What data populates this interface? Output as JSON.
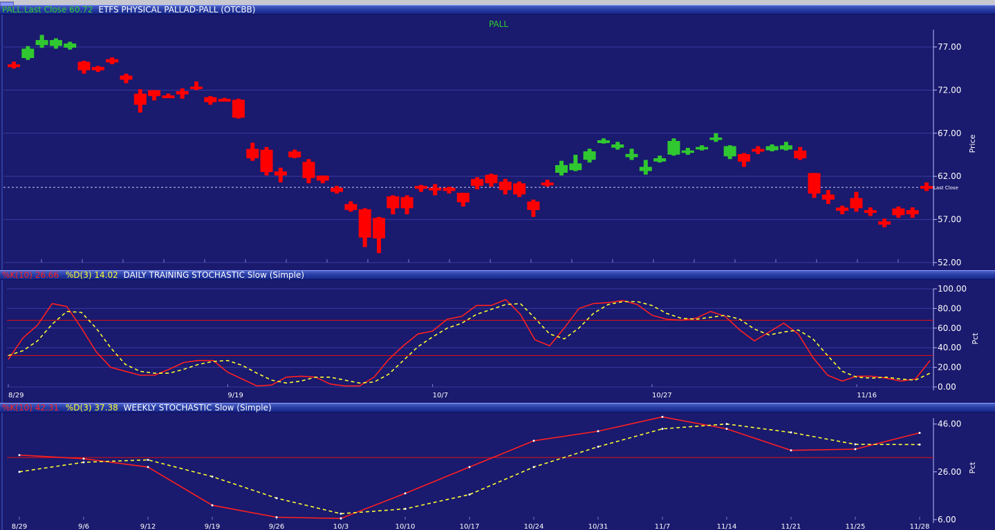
{
  "panels": {
    "price": {
      "header": {
        "symbol_close": "PALL.Last Close 60.72",
        "name": "ETFS PHYSICAL PALLAD-PALL (OTCBB)"
      },
      "title": "PALL",
      "ylabel": "Price",
      "last_close_label": "Last Close",
      "colors": {
        "up": "#30c830",
        "down": "#ff0000",
        "title": "#30d030"
      }
    },
    "daily": {
      "header": {
        "k": "%K(10) 26.66",
        "d": "%D(3) 14.02",
        "name": "DAILY TRAINING STOCHASTIC Slow (Simple)"
      },
      "ylabel": "Pct",
      "colors": {
        "k": "#ff2020",
        "d": "#ffff30"
      }
    },
    "weekly": {
      "header": {
        "k": "%K(10) 42.31",
        "d": "%D(3) 37.38",
        "name": "WEEKLY STOCHASTIC Slow (Simple)"
      },
      "ylabel": "Pct",
      "colors": {
        "k": "#ff2020",
        "d": "#ffff30"
      }
    }
  },
  "chart_data": [
    {
      "type": "candlestick",
      "title": "PALL",
      "ylabel": "Price",
      "ylim": [
        52,
        79
      ],
      "yticks": [
        "77.00",
        "72.00",
        "67.00",
        "62.00",
        "57.00",
        "52.00"
      ],
      "ytick_values": [
        77,
        72,
        67,
        62,
        57,
        52
      ],
      "last_close": 60.72,
      "grid": true,
      "candles": [
        [
          74.9,
          75.3,
          74.5,
          74.9,
          "down"
        ],
        [
          75.8,
          77.1,
          75.5,
          76.8,
          "up"
        ],
        [
          77.3,
          78.4,
          76.9,
          77.8,
          "up"
        ],
        [
          77.2,
          78.0,
          76.8,
          77.8,
          "up"
        ],
        [
          77.0,
          77.6,
          76.7,
          77.4,
          "up"
        ],
        [
          75.2,
          75.4,
          73.9,
          74.3,
          "down"
        ],
        [
          74.6,
          74.8,
          74.1,
          74.3,
          "down"
        ],
        [
          75.5,
          75.8,
          75.0,
          75.2,
          "down"
        ],
        [
          73.6,
          73.9,
          72.8,
          73.2,
          "down"
        ],
        [
          71.5,
          72.1,
          69.4,
          70.3,
          "down"
        ],
        [
          71.9,
          72.0,
          70.8,
          71.3,
          "down"
        ],
        [
          71.3,
          71.6,
          71.1,
          71.3,
          "down"
        ],
        [
          71.8,
          72.2,
          71.0,
          71.5,
          "down"
        ],
        [
          72.2,
          73.0,
          72.0,
          72.4,
          "down"
        ],
        [
          71.1,
          71.3,
          70.3,
          70.6,
          "down"
        ],
        [
          70.9,
          71.1,
          70.7,
          70.9,
          "down"
        ],
        [
          70.8,
          71.0,
          68.7,
          68.8,
          "down"
        ],
        [
          65.1,
          65.9,
          63.8,
          64.1,
          "down"
        ],
        [
          65.0,
          65.4,
          62.1,
          62.5,
          "down"
        ],
        [
          62.5,
          63.0,
          61.3,
          62.1,
          "down"
        ],
        [
          64.8,
          65.1,
          64.1,
          64.2,
          "down"
        ],
        [
          63.6,
          64.0,
          61.2,
          61.8,
          "down"
        ],
        [
          62.0,
          62.1,
          61.2,
          61.5,
          "down"
        ],
        [
          60.6,
          60.9,
          60.0,
          60.2,
          "down"
        ],
        [
          58.7,
          59.1,
          57.9,
          58.1,
          "down"
        ],
        [
          58.1,
          58.3,
          53.8,
          54.9,
          "down"
        ],
        [
          57.1,
          57.3,
          53.1,
          54.8,
          "down"
        ],
        [
          59.6,
          59.8,
          57.6,
          58.3,
          "down"
        ],
        [
          59.5,
          59.8,
          57.6,
          58.3,
          "down"
        ],
        [
          60.8,
          61.0,
          60.2,
          60.6,
          "down"
        ],
        [
          60.6,
          61.1,
          59.8,
          60.4,
          "down"
        ],
        [
          60.6,
          60.8,
          60.0,
          60.3,
          "down"
        ],
        [
          60.0,
          60.1,
          58.5,
          59.0,
          "down"
        ],
        [
          61.6,
          61.9,
          60.5,
          60.9,
          "down"
        ],
        [
          62.1,
          62.3,
          60.8,
          61.2,
          "down"
        ],
        [
          61.3,
          61.7,
          59.9,
          60.4,
          "down"
        ],
        [
          61.1,
          61.4,
          59.6,
          59.9,
          "down"
        ],
        [
          59.0,
          59.3,
          57.3,
          58.1,
          "down"
        ],
        [
          61.2,
          61.6,
          60.8,
          61.1,
          "down"
        ],
        [
          62.5,
          63.8,
          62.1,
          63.3,
          "up"
        ],
        [
          62.8,
          64.5,
          62.6,
          63.5,
          "up"
        ],
        [
          64.0,
          65.2,
          63.6,
          64.9,
          "up"
        ],
        [
          66.1,
          66.4,
          65.8,
          66.1,
          "up"
        ],
        [
          65.4,
          66.0,
          65.1,
          65.7,
          "up"
        ],
        [
          64.3,
          65.2,
          63.9,
          64.6,
          "up"
        ],
        [
          62.7,
          63.9,
          62.2,
          63.1,
          "up"
        ],
        [
          63.8,
          64.4,
          63.6,
          64.1,
          "up"
        ],
        [
          64.6,
          66.4,
          64.4,
          66.1,
          "up"
        ],
        [
          64.8,
          65.3,
          64.5,
          65.0,
          "up"
        ],
        [
          65.2,
          65.6,
          65.0,
          65.4,
          "up"
        ],
        [
          66.3,
          67.0,
          66.0,
          66.5,
          "up"
        ],
        [
          64.4,
          65.6,
          64.0,
          65.5,
          "up"
        ],
        [
          64.5,
          64.7,
          63.1,
          63.7,
          "down"
        ],
        [
          65.1,
          65.5,
          64.6,
          64.9,
          "down"
        ],
        [
          65.1,
          65.7,
          64.9,
          65.5,
          "up"
        ],
        [
          65.2,
          66.0,
          65.0,
          65.6,
          "up"
        ],
        [
          64.9,
          65.4,
          63.9,
          64.1,
          "down"
        ],
        [
          62.3,
          62.4,
          59.5,
          60.0,
          "down"
        ],
        [
          59.8,
          60.4,
          58.8,
          59.3,
          "down"
        ],
        [
          58.3,
          58.6,
          57.6,
          58.0,
          "down"
        ],
        [
          59.4,
          60.2,
          57.9,
          58.3,
          "down"
        ],
        [
          58.0,
          58.4,
          57.4,
          57.8,
          "down"
        ],
        [
          56.7,
          57.1,
          56.1,
          56.4,
          "down"
        ],
        [
          58.2,
          58.5,
          57.2,
          57.5,
          "down"
        ],
        [
          58.0,
          58.4,
          57.2,
          57.6,
          "down"
        ],
        [
          60.8,
          61.3,
          60.3,
          60.6,
          "down"
        ]
      ]
    },
    {
      "type": "line",
      "title": "DAILY TRAINING STOCHASTIC Slow (Simple)",
      "ylabel": "Pct",
      "ylim": [
        0,
        100
      ],
      "yticks": [
        "100.00",
        "80.00",
        "60.00",
        "40.00",
        "20.00",
        "0.00"
      ],
      "ytick_values": [
        100,
        80,
        60,
        40,
        20,
        0
      ],
      "reference_lines": [
        68,
        32
      ],
      "x_ticks": [
        "8/29",
        "9/19",
        "10/7",
        "10/27",
        "11/16"
      ],
      "x_tick_index": [
        0,
        15,
        29,
        44,
        58
      ],
      "series": [
        {
          "name": "%K(10) 26.66",
          "style": "solid",
          "values": [
            28,
            50,
            63,
            85,
            82,
            60,
            36,
            20,
            16,
            12,
            12,
            18,
            25,
            27,
            27,
            15,
            8,
            1,
            2,
            10,
            11,
            10,
            3,
            1,
            1,
            10,
            28,
            42,
            54,
            57,
            69,
            72,
            83,
            83,
            89,
            74,
            48,
            42,
            60,
            80,
            85,
            86,
            88,
            84,
            73,
            69,
            68,
            70,
            77,
            72,
            58,
            47,
            56,
            65,
            54,
            30,
            12,
            6,
            11,
            11,
            9,
            6,
            8,
            27
          ]
        },
        {
          "name": "%D(3) 14.02",
          "style": "dashed",
          "values": [
            32,
            37,
            47,
            64,
            77,
            76,
            60,
            40,
            23,
            16,
            14,
            14,
            18,
            23,
            26,
            27,
            22,
            14,
            7,
            4,
            6,
            10,
            10,
            7,
            4,
            5,
            13,
            27,
            41,
            51,
            60,
            65,
            74,
            79,
            84,
            85,
            70,
            54,
            49,
            60,
            75,
            84,
            87,
            87,
            83,
            75,
            70,
            69,
            71,
            73,
            69,
            59,
            53,
            56,
            58,
            49,
            32,
            16,
            10,
            9,
            10,
            8,
            7,
            14
          ]
        }
      ]
    },
    {
      "type": "line",
      "title": "WEEKLY STOCHASTIC Slow (Simple)",
      "ylabel": "Pct",
      "ylim": [
        6,
        48.5
      ],
      "yticks": [
        "46.00",
        "26.00",
        "6.00"
      ],
      "ytick_values": [
        46,
        26,
        6
      ],
      "reference_lines": [
        32
      ],
      "x": [
        "8/29",
        "9/6",
        "9/12",
        "9/19",
        "9/26",
        "10/3",
        "10/10",
        "10/17",
        "10/24",
        "10/31",
        "11/7",
        "11/14",
        "11/21",
        "11/25",
        "11/28"
      ],
      "series": [
        {
          "name": "%K(10) 42.31",
          "style": "solid",
          "markers": true,
          "values": [
            33,
            31.5,
            28,
            12,
            7,
            6.5,
            17,
            28,
            39,
            43,
            49,
            44,
            35,
            35.5,
            42.3
          ]
        },
        {
          "name": "%D(3) 37.38",
          "style": "dashed",
          "markers": true,
          "values": [
            26,
            30,
            31,
            24,
            15,
            8.5,
            10.5,
            16.5,
            28,
            36.5,
            44,
            46,
            42.5,
            37.5,
            37.4
          ]
        }
      ]
    }
  ]
}
